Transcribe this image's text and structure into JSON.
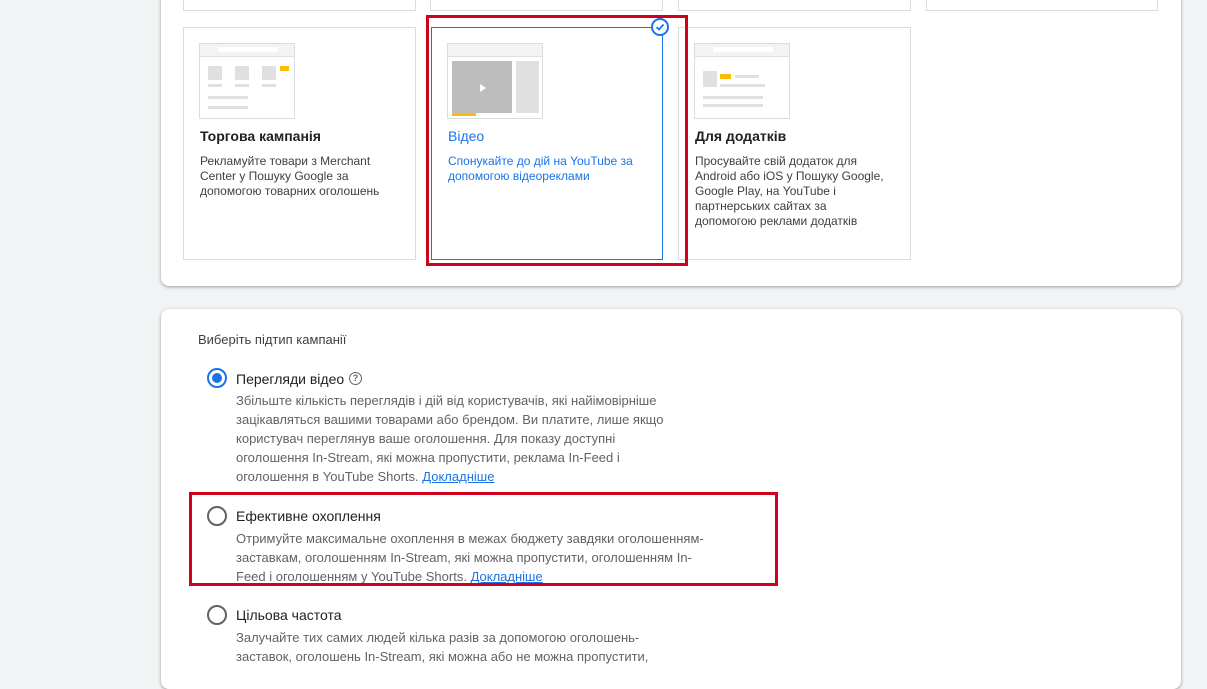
{
  "campaign_types": {
    "cards": [
      {
        "title": "Торгова кампанія",
        "description": "Рекламуйте товари з Merchant Center у Пошуку Google за допомогою товарних оголошень",
        "selected": false,
        "icon": "shopping-thumbnail"
      },
      {
        "title": "Відео",
        "description": "Спонукайте до дій на YouTube за допомогою відеореклами",
        "selected": true,
        "icon": "video-thumbnail"
      },
      {
        "title": "Для додатків",
        "description": "Просувайте свій додаток для Android або iOS у Пошуку Google, Google Play, на YouTube і партнерських сайтах за допомогою реклами додатків",
        "selected": false,
        "icon": "app-thumbnail"
      }
    ]
  },
  "subtype": {
    "title": "Виберіть підтип кампанії",
    "options": [
      {
        "label": "Перегляди відео",
        "checked": true,
        "help_icon": "help-icon",
        "description": "Збільште кількість переглядів і дій від користувачів, які найімовірніше зацікавляться вашими товарами або брендом. Ви платите, лише якщо користувач переглянув ваше оголошення. Для показу доступні оголошення In-Stream, які можна пропустити, реклама In-Feed і оголошення в YouTube Shorts.",
        "link": "Докладніше"
      },
      {
        "label": "Ефективне охоплення",
        "checked": false,
        "description": "Отримуйте максимальне охоплення в межах бюджету завдяки оголошенням-заставкам, оголошенням In-Stream, які можна пропустити, оголошенням In-Feed і оголошенням у YouTube Shorts.",
        "link": "Докладніше"
      },
      {
        "label": "Цільова частота",
        "checked": false,
        "description": "Залучайте тих самих людей кілька разів за допомогою оголошень-заставок, оголошень In-Stream, які можна або не можна пропустити,"
      }
    ]
  },
  "colors": {
    "accent": "#1a73e8",
    "highlight": "#d0021b",
    "yellow": "#fbbc04"
  }
}
